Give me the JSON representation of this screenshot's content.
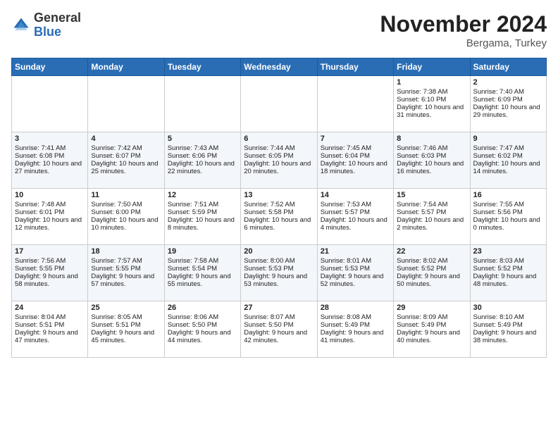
{
  "header": {
    "logo_general": "General",
    "logo_blue": "Blue",
    "month_title": "November 2024",
    "location": "Bergama, Turkey"
  },
  "days_of_week": [
    "Sunday",
    "Monday",
    "Tuesday",
    "Wednesday",
    "Thursday",
    "Friday",
    "Saturday"
  ],
  "weeks": [
    [
      {
        "day": "",
        "sunrise": "",
        "sunset": "",
        "daylight": "",
        "empty": true
      },
      {
        "day": "",
        "sunrise": "",
        "sunset": "",
        "daylight": "",
        "empty": true
      },
      {
        "day": "",
        "sunrise": "",
        "sunset": "",
        "daylight": "",
        "empty": true
      },
      {
        "day": "",
        "sunrise": "",
        "sunset": "",
        "daylight": "",
        "empty": true
      },
      {
        "day": "",
        "sunrise": "",
        "sunset": "",
        "daylight": "",
        "empty": true
      },
      {
        "day": "1",
        "sunrise": "Sunrise: 7:38 AM",
        "sunset": "Sunset: 6:10 PM",
        "daylight": "Daylight: 10 hours and 31 minutes.",
        "empty": false
      },
      {
        "day": "2",
        "sunrise": "Sunrise: 7:40 AM",
        "sunset": "Sunset: 6:09 PM",
        "daylight": "Daylight: 10 hours and 29 minutes.",
        "empty": false
      }
    ],
    [
      {
        "day": "3",
        "sunrise": "Sunrise: 7:41 AM",
        "sunset": "Sunset: 6:08 PM",
        "daylight": "Daylight: 10 hours and 27 minutes.",
        "empty": false
      },
      {
        "day": "4",
        "sunrise": "Sunrise: 7:42 AM",
        "sunset": "Sunset: 6:07 PM",
        "daylight": "Daylight: 10 hours and 25 minutes.",
        "empty": false
      },
      {
        "day": "5",
        "sunrise": "Sunrise: 7:43 AM",
        "sunset": "Sunset: 6:06 PM",
        "daylight": "Daylight: 10 hours and 22 minutes.",
        "empty": false
      },
      {
        "day": "6",
        "sunrise": "Sunrise: 7:44 AM",
        "sunset": "Sunset: 6:05 PM",
        "daylight": "Daylight: 10 hours and 20 minutes.",
        "empty": false
      },
      {
        "day": "7",
        "sunrise": "Sunrise: 7:45 AM",
        "sunset": "Sunset: 6:04 PM",
        "daylight": "Daylight: 10 hours and 18 minutes.",
        "empty": false
      },
      {
        "day": "8",
        "sunrise": "Sunrise: 7:46 AM",
        "sunset": "Sunset: 6:03 PM",
        "daylight": "Daylight: 10 hours and 16 minutes.",
        "empty": false
      },
      {
        "day": "9",
        "sunrise": "Sunrise: 7:47 AM",
        "sunset": "Sunset: 6:02 PM",
        "daylight": "Daylight: 10 hours and 14 minutes.",
        "empty": false
      }
    ],
    [
      {
        "day": "10",
        "sunrise": "Sunrise: 7:48 AM",
        "sunset": "Sunset: 6:01 PM",
        "daylight": "Daylight: 10 hours and 12 minutes.",
        "empty": false
      },
      {
        "day": "11",
        "sunrise": "Sunrise: 7:50 AM",
        "sunset": "Sunset: 6:00 PM",
        "daylight": "Daylight: 10 hours and 10 minutes.",
        "empty": false
      },
      {
        "day": "12",
        "sunrise": "Sunrise: 7:51 AM",
        "sunset": "Sunset: 5:59 PM",
        "daylight": "Daylight: 10 hours and 8 minutes.",
        "empty": false
      },
      {
        "day": "13",
        "sunrise": "Sunrise: 7:52 AM",
        "sunset": "Sunset: 5:58 PM",
        "daylight": "Daylight: 10 hours and 6 minutes.",
        "empty": false
      },
      {
        "day": "14",
        "sunrise": "Sunrise: 7:53 AM",
        "sunset": "Sunset: 5:57 PM",
        "daylight": "Daylight: 10 hours and 4 minutes.",
        "empty": false
      },
      {
        "day": "15",
        "sunrise": "Sunrise: 7:54 AM",
        "sunset": "Sunset: 5:57 PM",
        "daylight": "Daylight: 10 hours and 2 minutes.",
        "empty": false
      },
      {
        "day": "16",
        "sunrise": "Sunrise: 7:55 AM",
        "sunset": "Sunset: 5:56 PM",
        "daylight": "Daylight: 10 hours and 0 minutes.",
        "empty": false
      }
    ],
    [
      {
        "day": "17",
        "sunrise": "Sunrise: 7:56 AM",
        "sunset": "Sunset: 5:55 PM",
        "daylight": "Daylight: 9 hours and 58 minutes.",
        "empty": false
      },
      {
        "day": "18",
        "sunrise": "Sunrise: 7:57 AM",
        "sunset": "Sunset: 5:55 PM",
        "daylight": "Daylight: 9 hours and 57 minutes.",
        "empty": false
      },
      {
        "day": "19",
        "sunrise": "Sunrise: 7:58 AM",
        "sunset": "Sunset: 5:54 PM",
        "daylight": "Daylight: 9 hours and 55 minutes.",
        "empty": false
      },
      {
        "day": "20",
        "sunrise": "Sunrise: 8:00 AM",
        "sunset": "Sunset: 5:53 PM",
        "daylight": "Daylight: 9 hours and 53 minutes.",
        "empty": false
      },
      {
        "day": "21",
        "sunrise": "Sunrise: 8:01 AM",
        "sunset": "Sunset: 5:53 PM",
        "daylight": "Daylight: 9 hours and 52 minutes.",
        "empty": false
      },
      {
        "day": "22",
        "sunrise": "Sunrise: 8:02 AM",
        "sunset": "Sunset: 5:52 PM",
        "daylight": "Daylight: 9 hours and 50 minutes.",
        "empty": false
      },
      {
        "day": "23",
        "sunrise": "Sunrise: 8:03 AM",
        "sunset": "Sunset: 5:52 PM",
        "daylight": "Daylight: 9 hours and 48 minutes.",
        "empty": false
      }
    ],
    [
      {
        "day": "24",
        "sunrise": "Sunrise: 8:04 AM",
        "sunset": "Sunset: 5:51 PM",
        "daylight": "Daylight: 9 hours and 47 minutes.",
        "empty": false
      },
      {
        "day": "25",
        "sunrise": "Sunrise: 8:05 AM",
        "sunset": "Sunset: 5:51 PM",
        "daylight": "Daylight: 9 hours and 45 minutes.",
        "empty": false
      },
      {
        "day": "26",
        "sunrise": "Sunrise: 8:06 AM",
        "sunset": "Sunset: 5:50 PM",
        "daylight": "Daylight: 9 hours and 44 minutes.",
        "empty": false
      },
      {
        "day": "27",
        "sunrise": "Sunrise: 8:07 AM",
        "sunset": "Sunset: 5:50 PM",
        "daylight": "Daylight: 9 hours and 42 minutes.",
        "empty": false
      },
      {
        "day": "28",
        "sunrise": "Sunrise: 8:08 AM",
        "sunset": "Sunset: 5:49 PM",
        "daylight": "Daylight: 9 hours and 41 minutes.",
        "empty": false
      },
      {
        "day": "29",
        "sunrise": "Sunrise: 8:09 AM",
        "sunset": "Sunset: 5:49 PM",
        "daylight": "Daylight: 9 hours and 40 minutes.",
        "empty": false
      },
      {
        "day": "30",
        "sunrise": "Sunrise: 8:10 AM",
        "sunset": "Sunset: 5:49 PM",
        "daylight": "Daylight: 9 hours and 38 minutes.",
        "empty": false
      }
    ]
  ]
}
